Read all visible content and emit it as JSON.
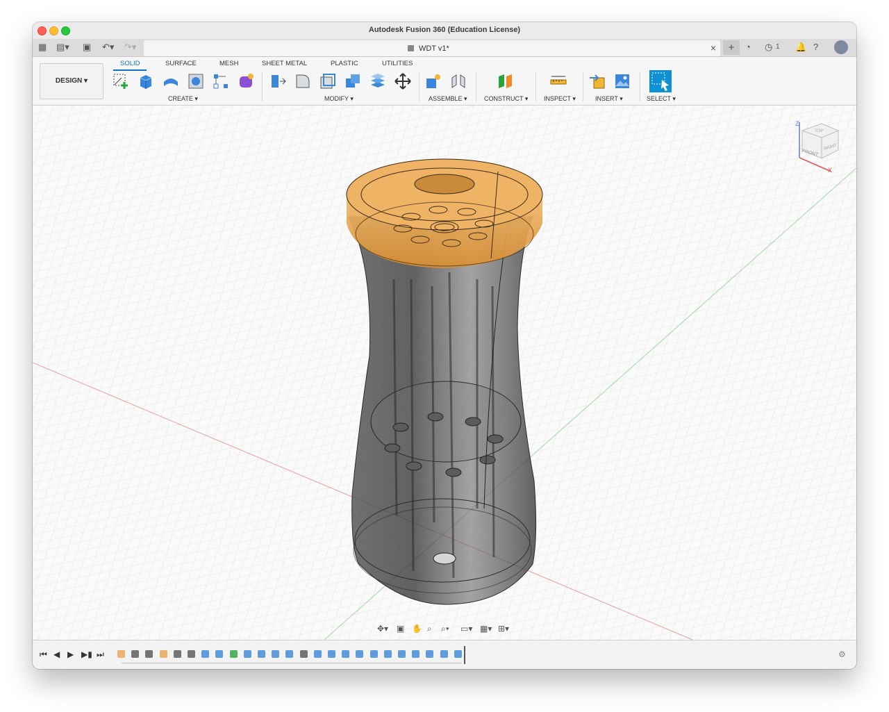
{
  "window": {
    "title": "Autodesk Fusion 360 (Education License)"
  },
  "tabbar": {
    "doc_name": "WDT v1*",
    "notifications_count": "1"
  },
  "ribbon": {
    "workspace": "DESIGN",
    "tabs": [
      "SOLID",
      "SURFACE",
      "MESH",
      "SHEET METAL",
      "PLASTIC",
      "UTILITIES"
    ],
    "groups": [
      "CREATE",
      "MODIFY",
      "ASSEMBLE",
      "CONSTRUCT",
      "INSPECT",
      "INSERT",
      "SELECT"
    ]
  },
  "viewcube": {
    "top": "TOP",
    "front": "FRONT",
    "right": "RIGHT",
    "axis_z": "Z",
    "axis_x": "X"
  },
  "colors": {
    "accent": "#0f72c9",
    "lid": "#e9a24a",
    "body": "#4a4a4a",
    "grid": "#e4e4e4"
  },
  "timeline": {
    "controls": [
      "skip-start",
      "step-back",
      "play",
      "step-forward",
      "skip-end"
    ]
  }
}
